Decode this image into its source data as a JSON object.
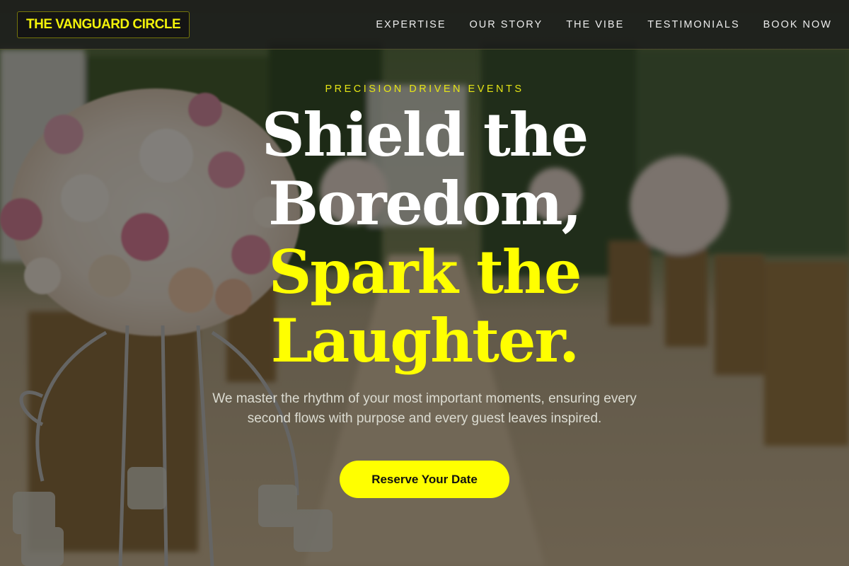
{
  "header": {
    "logo": "THE VANGUARD CIRCLE",
    "nav": [
      {
        "label": "EXPERTISE"
      },
      {
        "label": "OUR STORY"
      },
      {
        "label": "THE VIBE"
      },
      {
        "label": "TESTIMONIALS"
      },
      {
        "label": "BOOK NOW"
      }
    ]
  },
  "hero": {
    "eyebrow": "PRECISION DRIVEN EVENTS",
    "headline": {
      "line1": "Shield the",
      "line2": "Boredom,",
      "line3": "Spark the",
      "line4": "Laughter."
    },
    "subtext": "We master the rhythm of your most important moments, ensuring every second flows with purpose and every guest leaves inspired.",
    "cta_label": "Reserve Your Date"
  },
  "colors": {
    "accent": "#ffff00",
    "header_bg": "#1c1c1c",
    "text_light": "#ffffff"
  }
}
